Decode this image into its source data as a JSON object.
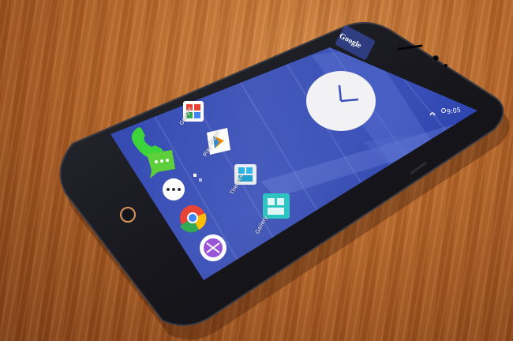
{
  "google_search_widget": "Google",
  "status_bar": {
    "time": "9:05"
  },
  "apps": [
    {
      "label": "Google",
      "icon": "google-app-icon"
    },
    {
      "label": "Play Store",
      "icon": "play-store-icon"
    },
    {
      "label": "Themes",
      "icon": "themes-icon"
    },
    {
      "label": "Gallery",
      "icon": "gallery-icon"
    }
  ],
  "dock": [
    {
      "icon": "phone-icon"
    },
    {
      "icon": "messaging-icon"
    },
    {
      "icon": "app-drawer-icon"
    },
    {
      "icon": "chrome-icon"
    },
    {
      "icon": "camera-icon"
    }
  ],
  "colors": {
    "wallpaper": "#2a3fa8",
    "phone_body": "#1b1b22",
    "table_wood": "#b4662a",
    "home_ring": "#d9935a"
  }
}
